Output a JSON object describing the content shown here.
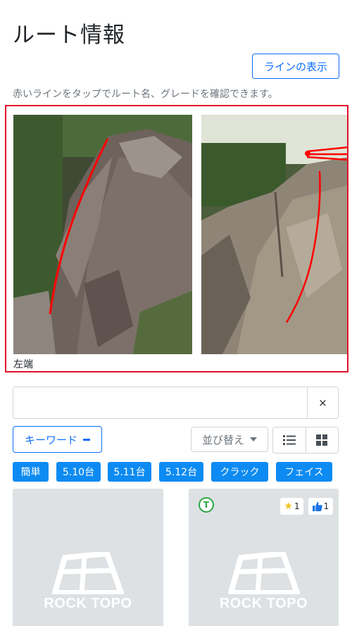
{
  "page": {
    "title": "ルート情報"
  },
  "toolbar": {
    "show_lines_label": "ラインの表示"
  },
  "hint": "赤いラインをタップでルート名、グレードを確認できます。",
  "photos": {
    "caption": "左端"
  },
  "search": {
    "value": "",
    "placeholder": "",
    "clear_label": "×"
  },
  "filters": {
    "keyword_label": "キーワード",
    "sort_label": "並び替え",
    "view_modes": [
      "list-view-icon",
      "grid-view-icon"
    ]
  },
  "tags": [
    "簡単",
    "5.10台",
    "5.11台",
    "5.12台",
    "クラック",
    "フェイス"
  ],
  "cards": [
    {
      "logo_text": "ROCK TOPO"
    },
    {
      "logo_text": "ROCK TOPO",
      "badge": "T",
      "star_count": "1",
      "like_count": "1"
    }
  ],
  "colors": {
    "accent": "#0d6efd",
    "tag": "#0d8bf2",
    "frame": "#e0102a",
    "route_line": "#ff0000"
  }
}
